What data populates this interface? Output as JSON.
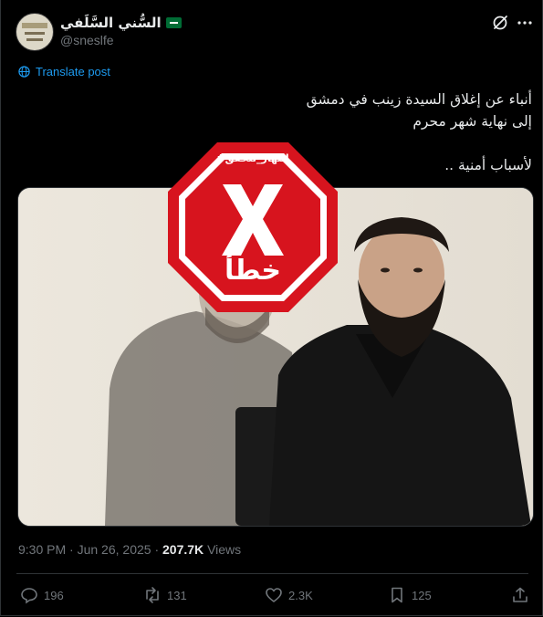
{
  "user": {
    "display_name": "السُّني السَّلَفي",
    "handle": "@sneslfe",
    "badge": "saudi-flag-icon"
  },
  "translate_label": "Translate post",
  "post": {
    "line1": "أنباء عن إغلاق السيدة زينب في دمشق",
    "line2": "إلى نهاية شهر محرم",
    "line3": "لأسباب أمنية .."
  },
  "stamp": {
    "hashtag": "#النهار_تتحقق",
    "verdict": "خطأ",
    "color": "#d7141e"
  },
  "meta": {
    "time": "9:30 PM",
    "date": "Jun 26, 2025",
    "views_count": "207.7K",
    "views_label": "Views"
  },
  "actions": {
    "replies": "196",
    "reposts": "131",
    "likes": "2.3K",
    "bookmarks": "125"
  },
  "colors": {
    "background": "#000000",
    "text": "#e7e9ea",
    "muted": "#71767b",
    "accent": "#1d9bf0"
  }
}
